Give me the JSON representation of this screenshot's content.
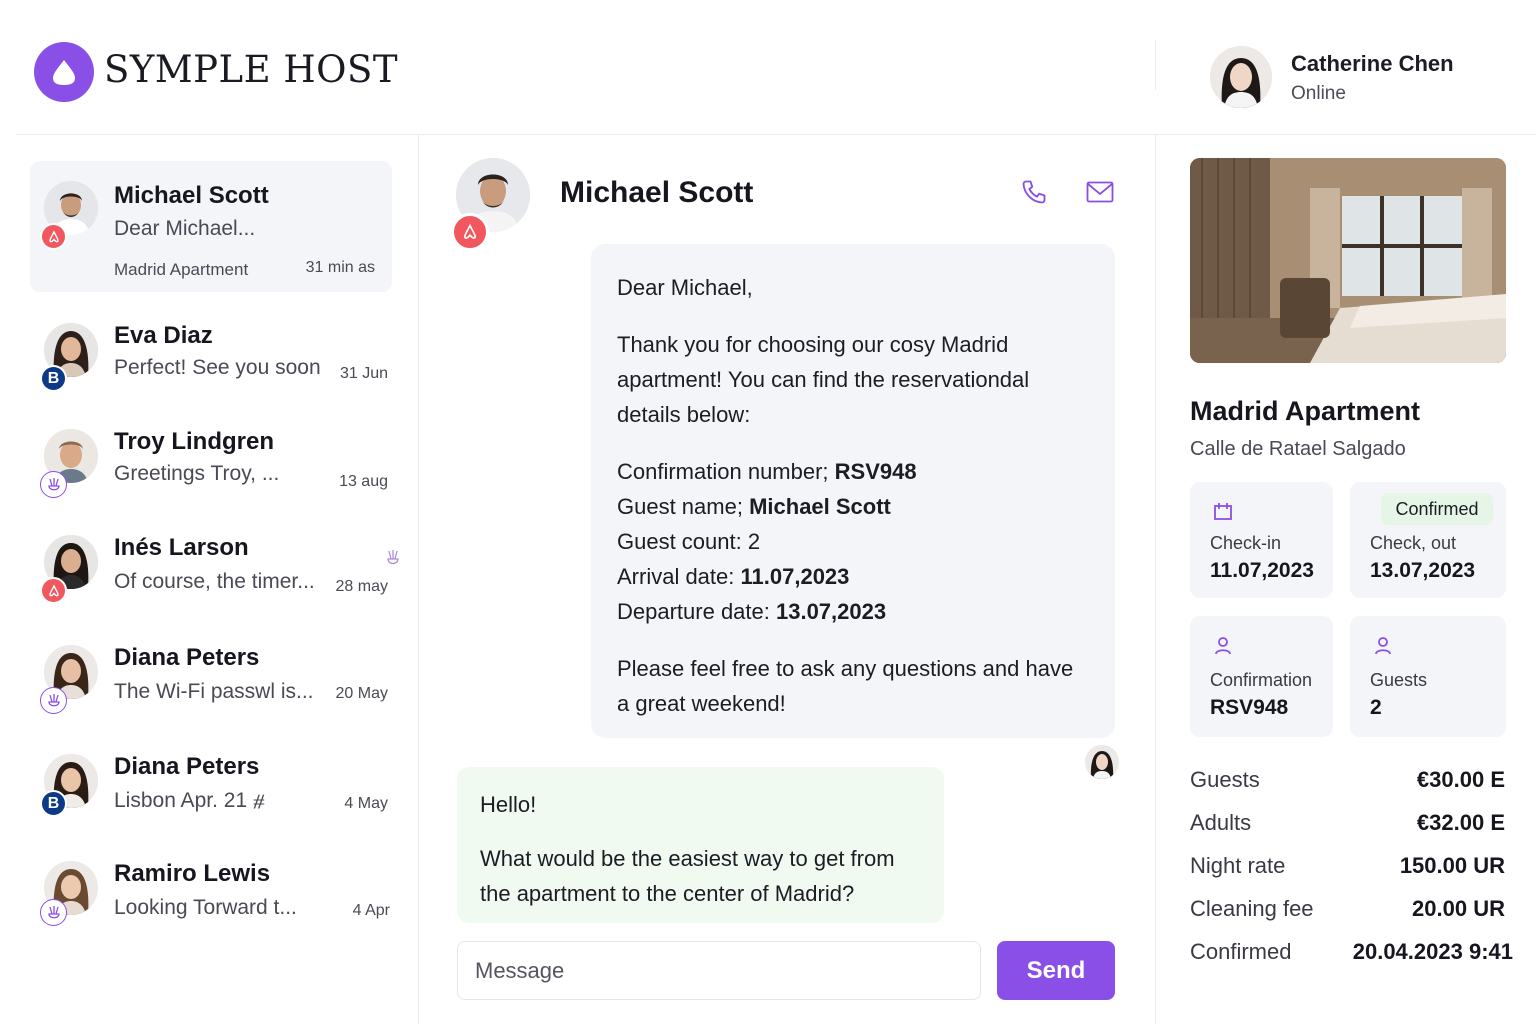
{
  "app": {
    "brand": "SYMPLE HOST"
  },
  "user": {
    "name": "Catherine Chen",
    "status": "Online"
  },
  "conversations": [
    {
      "name": "Michael Scott",
      "preview": "Dear Michael...",
      "listing": "Madrid Apartment",
      "time": "31 min as",
      "channel": "airbnb"
    },
    {
      "name": "Eva Diaz",
      "preview": "Perfect! See you soon",
      "time": "31 Jun",
      "channel": "booking"
    },
    {
      "name": "Troy Lindgren",
      "preview": "Greetings Troy, ...",
      "time": "13 aug",
      "channel": "vrbo"
    },
    {
      "name": "Inés Larson",
      "preview": "Of course, the timer...",
      "time": "28 may",
      "channel": "airbnb"
    },
    {
      "name": "Diana Peters",
      "preview": "The Wi-Fi passwl is...",
      "time": "20 May",
      "channel": "vrbo"
    },
    {
      "name": "Diana Peters",
      "preview": "Lisbon Apr. 21 ⧣",
      "time": "4 May",
      "channel": "booking"
    },
    {
      "name": "Ramiro Lewis",
      "preview": "Looking Torward t...",
      "time": "4 Apr",
      "channel": "vrbo"
    }
  ],
  "chat": {
    "name": "Michael Scott",
    "host_message": {
      "greeting": "Dear Michael,",
      "intro": "Thank you for choosing our cosy Madrid apartment! You can find the reservationdal details below:",
      "confirmation_label": "Confirmation number; ",
      "confirmation_value": "RSV948",
      "guest_name_label": "Guest name; ",
      "guest_name_value": "Michael Scott",
      "guest_count_label": "Guest count: ",
      "guest_count_value": "2",
      "arrival_label": "Arrival date: ",
      "arrival_value": "11.07,2023",
      "departure_label": "Departure date: ",
      "departure_value": "13.07,2023",
      "closing": "Please feel free to ask any questions and have a great weekend!"
    },
    "guest_message": {
      "greeting": "Hello!",
      "body": "What would be the easiest way to get from the apartment to the center of Madrid?"
    },
    "composer_placeholder": "Message",
    "send_label": "Send"
  },
  "property": {
    "title": "Madrid Apartment",
    "address": "Calle de Ratael Salgado",
    "status_badge": "Confirmed",
    "checkin_label": "Check-in",
    "checkin_value": "11.07,2023",
    "checkout_label": "Check, out",
    "checkout_value": "13.07,2023",
    "confirmation_label": "Confirmation",
    "confirmation_value": "RSV948",
    "guests_label": "Guests",
    "guests_value": "2",
    "price_rows": [
      {
        "label": "Guests",
        "value": "€30.00 E"
      },
      {
        "label": "Adults",
        "value": "€32.00 E"
      },
      {
        "label": "Night rate",
        "value": "150.00 UR"
      },
      {
        "label": "Cleaning fee",
        "value": "20.00 UR"
      },
      {
        "label": "Confirmed",
        "value": "20.04.2023 9:41"
      }
    ]
  },
  "colors": {
    "accent": "#8a4fe6",
    "airbnb": "#f0575e",
    "booking": "#0c3a86",
    "guest_bubble": "#f0faf0",
    "host_bubble": "#f4f5f9"
  }
}
